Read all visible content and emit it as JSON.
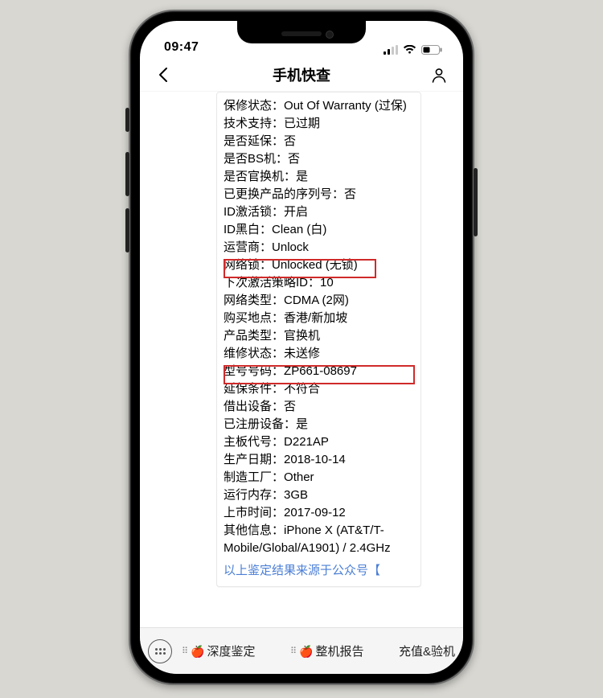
{
  "status": {
    "time": "09:47"
  },
  "nav": {
    "title": "手机快查"
  },
  "report": {
    "rows": [
      {
        "label": "保修状态",
        "value": "Out Of Warranty (过保)"
      },
      {
        "label": "技术支持",
        "value": "已过期"
      },
      {
        "label": "是否延保",
        "value": "否"
      },
      {
        "label": "是否BS机",
        "value": "否"
      },
      {
        "label": "是否官换机",
        "value": "是"
      },
      {
        "label": "已更换产品的序列号",
        "value": "否"
      },
      {
        "label": "ID激活锁",
        "value": "开启"
      },
      {
        "label": "ID黑白",
        "value": "Clean (白)"
      },
      {
        "label": "运营商",
        "value": "Unlock"
      },
      {
        "label": "网络锁",
        "value": "Unlocked (无锁)"
      },
      {
        "label": "下次激活策略ID",
        "value": "10"
      },
      {
        "label": "网络类型",
        "value": "CDMA (2网)"
      },
      {
        "label": "购买地点",
        "value": "香港/新加坡"
      },
      {
        "label": "产品类型",
        "value": "官换机"
      },
      {
        "label": "维修状态",
        "value": "未送修"
      },
      {
        "label": "型号号码",
        "value": "ZP661-08697"
      },
      {
        "label": "延保条件",
        "value": "不符合"
      },
      {
        "label": "借出设备",
        "value": "否"
      },
      {
        "label": "已注册设备",
        "value": "是"
      },
      {
        "label": "主板代号",
        "value": "D221AP"
      },
      {
        "label": "生产日期",
        "value": "2018-10-14"
      },
      {
        "label": "制造工厂",
        "value": "Other"
      },
      {
        "label": "运行内存",
        "value": "3GB"
      },
      {
        "label": "上市时间",
        "value": "2017-09-12"
      },
      {
        "label": "其他信息",
        "value": "iPhone X (AT&T/T-Mobile/Global/A1901) / 2.4GHz"
      }
    ],
    "footnote": "以上鉴定结果来源于公众号【"
  },
  "bottom": {
    "action1": "深度鉴定",
    "action2": "整机报告",
    "action3": "充值&验机"
  },
  "separator": "：",
  "apple_emoji": "🍎"
}
